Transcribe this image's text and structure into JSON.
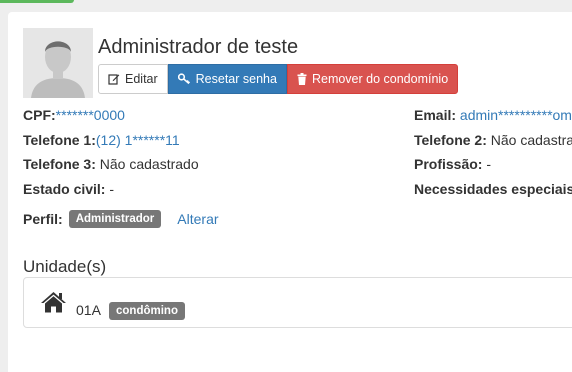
{
  "profile": {
    "name": "Administrador de teste",
    "buttons": {
      "edit": "Editar",
      "reset_password": "Resetar senha",
      "remove": "Remover do condomínio"
    },
    "fields": {
      "cpf_label": "CPF:",
      "cpf_value": "*******0000",
      "email_label": "Email:",
      "email_value": "admin**********om.",
      "phone1_label": "Telefone 1:",
      "phone1_value": "(12) 1******11",
      "phone2_label": "Telefone 2:",
      "phone2_value": "Não cadastra",
      "phone3_label": "Telefone 3:",
      "phone3_value": "Não cadastrado",
      "profession_label": "Profissão:",
      "profession_value": "-",
      "civil_label": "Estado civil:",
      "civil_value": "-",
      "needs_label": "Necessidades especiais"
    },
    "perfil": {
      "label": "Perfil:",
      "value": "Administrador",
      "change_link": "Alterar"
    }
  },
  "units": {
    "title": "Unidade(s)",
    "items": [
      {
        "name": "01A",
        "badge": "condômino",
        "icon": "home-icon"
      }
    ]
  },
  "colors": {
    "primary": "#337ab7",
    "danger": "#d9534f",
    "badge": "#777777",
    "success_accent": "#5cb85c"
  }
}
